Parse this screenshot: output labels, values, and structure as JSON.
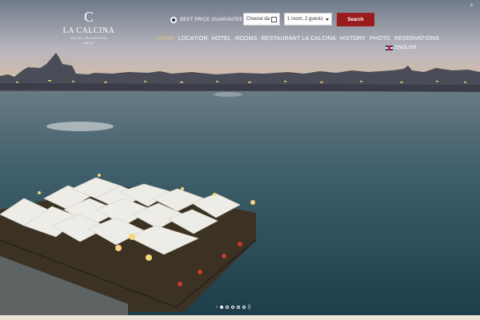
{
  "logo": {
    "mark": "C",
    "name": "LA CALCINA",
    "subtitle": "HOTEL RESIDENCE",
    "subtitle2": "ARCO"
  },
  "booking": {
    "best_price": "BEST PRICE GUARANTEED",
    "date_placeholder": "Choose da",
    "guests_value": "1 room, 2 guests",
    "search_label": "Search"
  },
  "close": {
    "label": "x"
  },
  "nav": {
    "items": [
      "HOME",
      "LOCATION",
      "HOTEL",
      "ROOMS",
      "RESTAURANT LA CALCINA",
      "HISTORY",
      "PHOTO",
      "RESERVATIONS"
    ],
    "active": "HOME"
  },
  "language": {
    "label": "ENGLISH"
  },
  "slider": {
    "prev": "›",
    "next": "||",
    "count": 5,
    "active_index": 0
  },
  "colors": {
    "accent": "#9b1c1c",
    "active_nav": "#e4c186"
  }
}
